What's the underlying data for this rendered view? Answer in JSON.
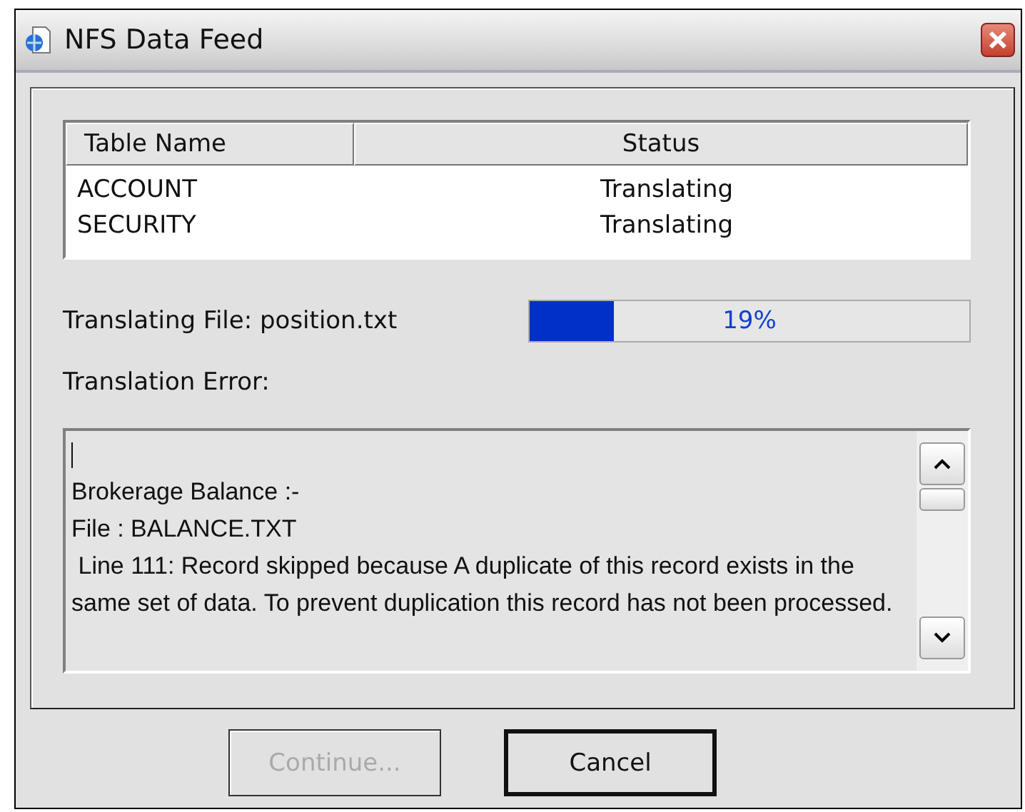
{
  "window": {
    "title": "NFS Data Feed"
  },
  "table": {
    "columns": [
      "Table Name",
      "Status"
    ],
    "rows": [
      {
        "cells": [
          "ACCOUNT",
          "Translating"
        ]
      },
      {
        "cells": [
          "SECURITY",
          "Translating"
        ]
      }
    ]
  },
  "progress": {
    "label": "Translating File: position.txt",
    "level": 0.19,
    "reading": "19%"
  },
  "error": {
    "label": "Translation Error:",
    "lines": [
      "Brokerage Balance :-",
      "File : BALANCE.TXT",
      " Line 111: Record skipped because A duplicate of this record exists in the same set of data. To prevent duplication this record has not been processed."
    ]
  },
  "buttons": [
    {
      "label": "Continue...",
      "disabled": true,
      "default": false
    },
    {
      "label": "Cancel",
      "disabled": false,
      "default": true
    }
  ]
}
